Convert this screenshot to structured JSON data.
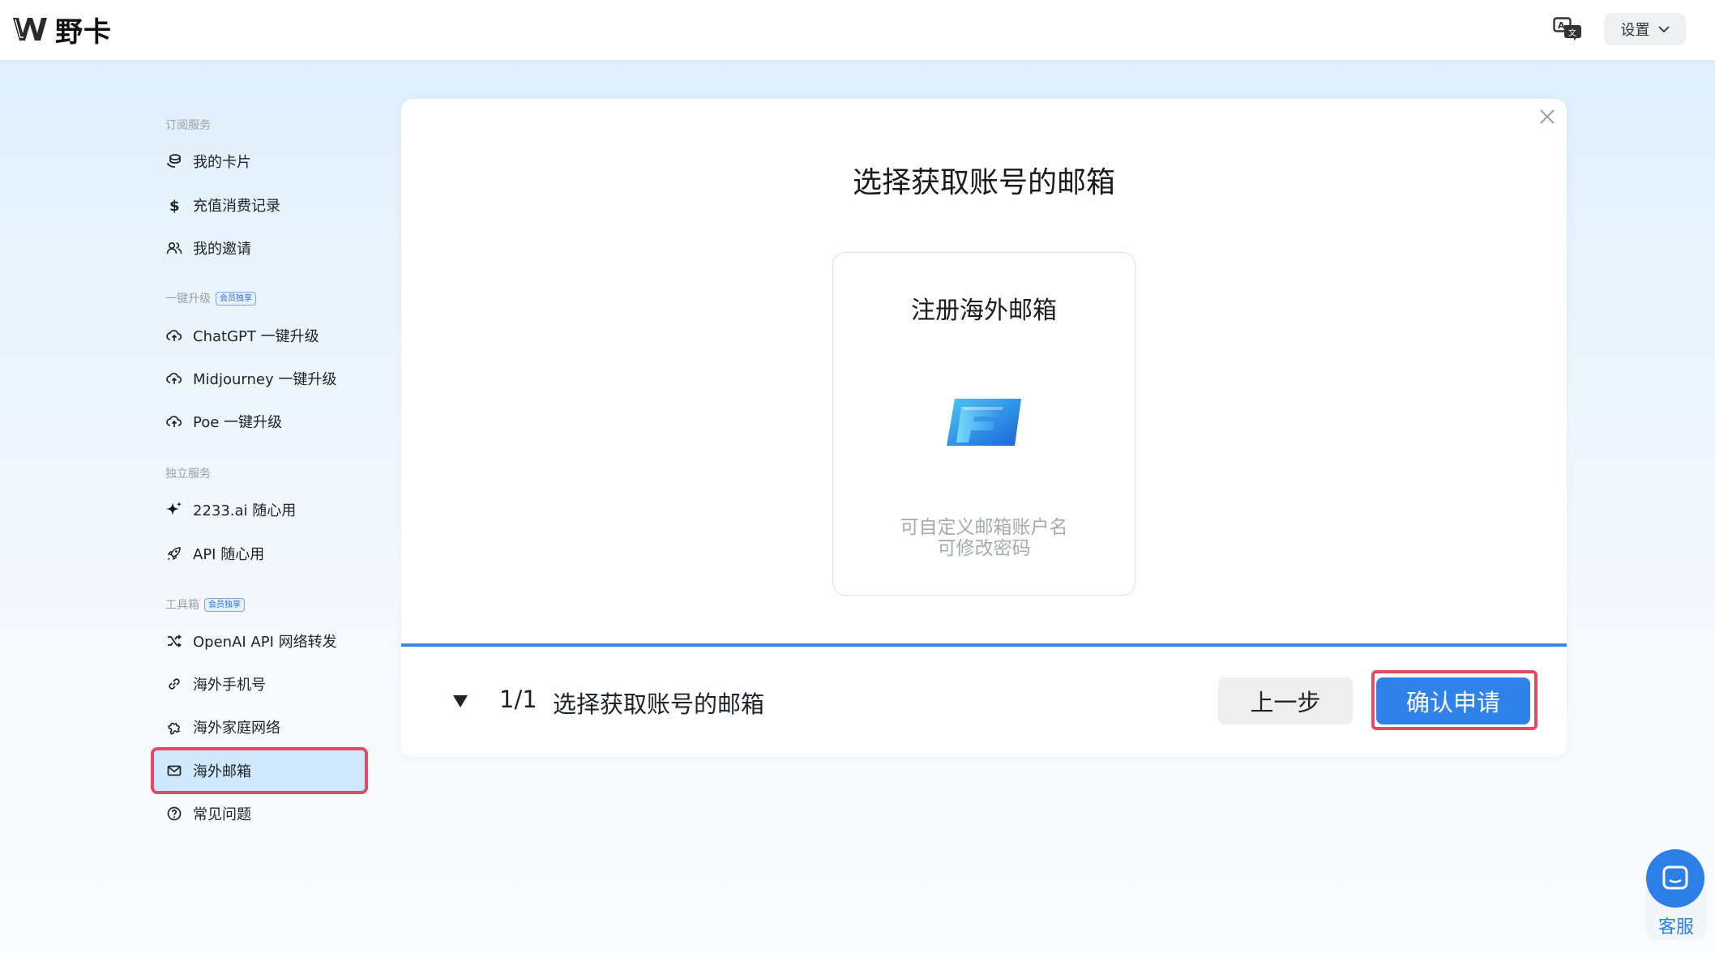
{
  "header": {
    "brand_name": "野卡",
    "settings_label": "设置"
  },
  "sidebar": {
    "sections": [
      {
        "label": "订阅服务",
        "badge": ""
      },
      {
        "label": "一键升级",
        "badge": "会员独享"
      },
      {
        "label": "独立服务",
        "badge": ""
      },
      {
        "label": "工具箱",
        "badge": "会员独享"
      }
    ],
    "items": [
      {
        "label": "我的卡片",
        "icon": "coins-icon"
      },
      {
        "label": "充值消费记录",
        "icon": "dollar-icon"
      },
      {
        "label": "我的邀请",
        "icon": "users-icon"
      },
      {
        "label": "ChatGPT 一键升级",
        "icon": "cloud-upload-icon"
      },
      {
        "label": "Midjourney 一键升级",
        "icon": "cloud-upload-icon"
      },
      {
        "label": "Poe 一键升级",
        "icon": "cloud-upload-icon"
      },
      {
        "label": "2233.ai 随心用",
        "icon": "sparkle-icon"
      },
      {
        "label": "API 随心用",
        "icon": "rocket-icon"
      },
      {
        "label": "OpenAI API 网络转发",
        "icon": "shuffle-icon"
      },
      {
        "label": "海外手机号",
        "icon": "phone-link-icon"
      },
      {
        "label": "海外家庭网络",
        "icon": "puzzle-icon"
      },
      {
        "label": "海外邮箱",
        "icon": "mail-icon"
      },
      {
        "label": "常见问题",
        "icon": "help-circle-icon"
      }
    ]
  },
  "dialog": {
    "title": "选择获取账号的邮箱",
    "option": {
      "title": "注册海外邮箱",
      "desc_line1": "可自定义邮箱账户名",
      "desc_line2": "可修改密码"
    },
    "step_count": "1/1",
    "step_label": "选择获取账号的邮箱",
    "prev_label": "上一步",
    "confirm_label": "确认申请"
  },
  "support": {
    "label": "客服"
  },
  "colors": {
    "accent": "#2f83e8",
    "highlight": "#e24a65",
    "active_bg": "#cfe8fb"
  }
}
